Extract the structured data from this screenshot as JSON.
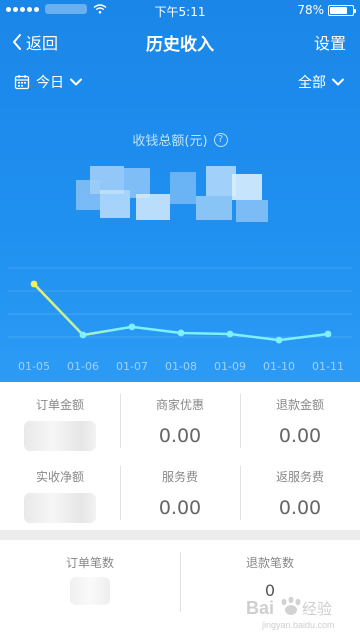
{
  "statusbar": {
    "time": "下午5:11",
    "battery": "78%",
    "battery_level": 0.78
  },
  "nav": {
    "back_label": "返回",
    "title": "历史收入",
    "settings_label": "设置"
  },
  "filters": {
    "date_label": "今日",
    "scope_label": "全部"
  },
  "summary": {
    "label": "收钱总额(元)",
    "help_glyph": "?"
  },
  "chart_data": {
    "type": "line",
    "categories": [
      "01-05",
      "01-06",
      "01-07",
      "01-08",
      "01-09",
      "01-10",
      "01-11"
    ],
    "series": [
      {
        "values": [
          1.0,
          0.0,
          0.16,
          0.04,
          0.02,
          -0.1,
          0.02
        ]
      }
    ],
    "title": "",
    "xlabel": "",
    "ylabel": "",
    "grid": true,
    "colors": {
      "line_start": "#f0f060",
      "line_end": "#7ff0ff"
    }
  },
  "stats": {
    "order_amount_label": "订单金额",
    "merchant_discount_label": "商家优惠",
    "merchant_discount_value": "0.00",
    "refund_amount_label": "退款金额",
    "refund_amount_value": "0.00",
    "net_received_label": "实收净额",
    "service_fee_label": "服务费",
    "service_fee_value": "0.00",
    "fee_rebate_label": "返服务费",
    "fee_rebate_value": "0.00"
  },
  "counts": {
    "order_count_label": "订单笔数",
    "refund_count_label": "退款笔数",
    "refund_count_value": "0"
  },
  "watermark": {
    "text": "Bai 经验",
    "subtext": "jingyan.baidu.com"
  },
  "colors": {
    "primary_blue": "#1a86e8",
    "line_yellow": "#f0f060",
    "line_cyan": "#7ff0ff"
  }
}
